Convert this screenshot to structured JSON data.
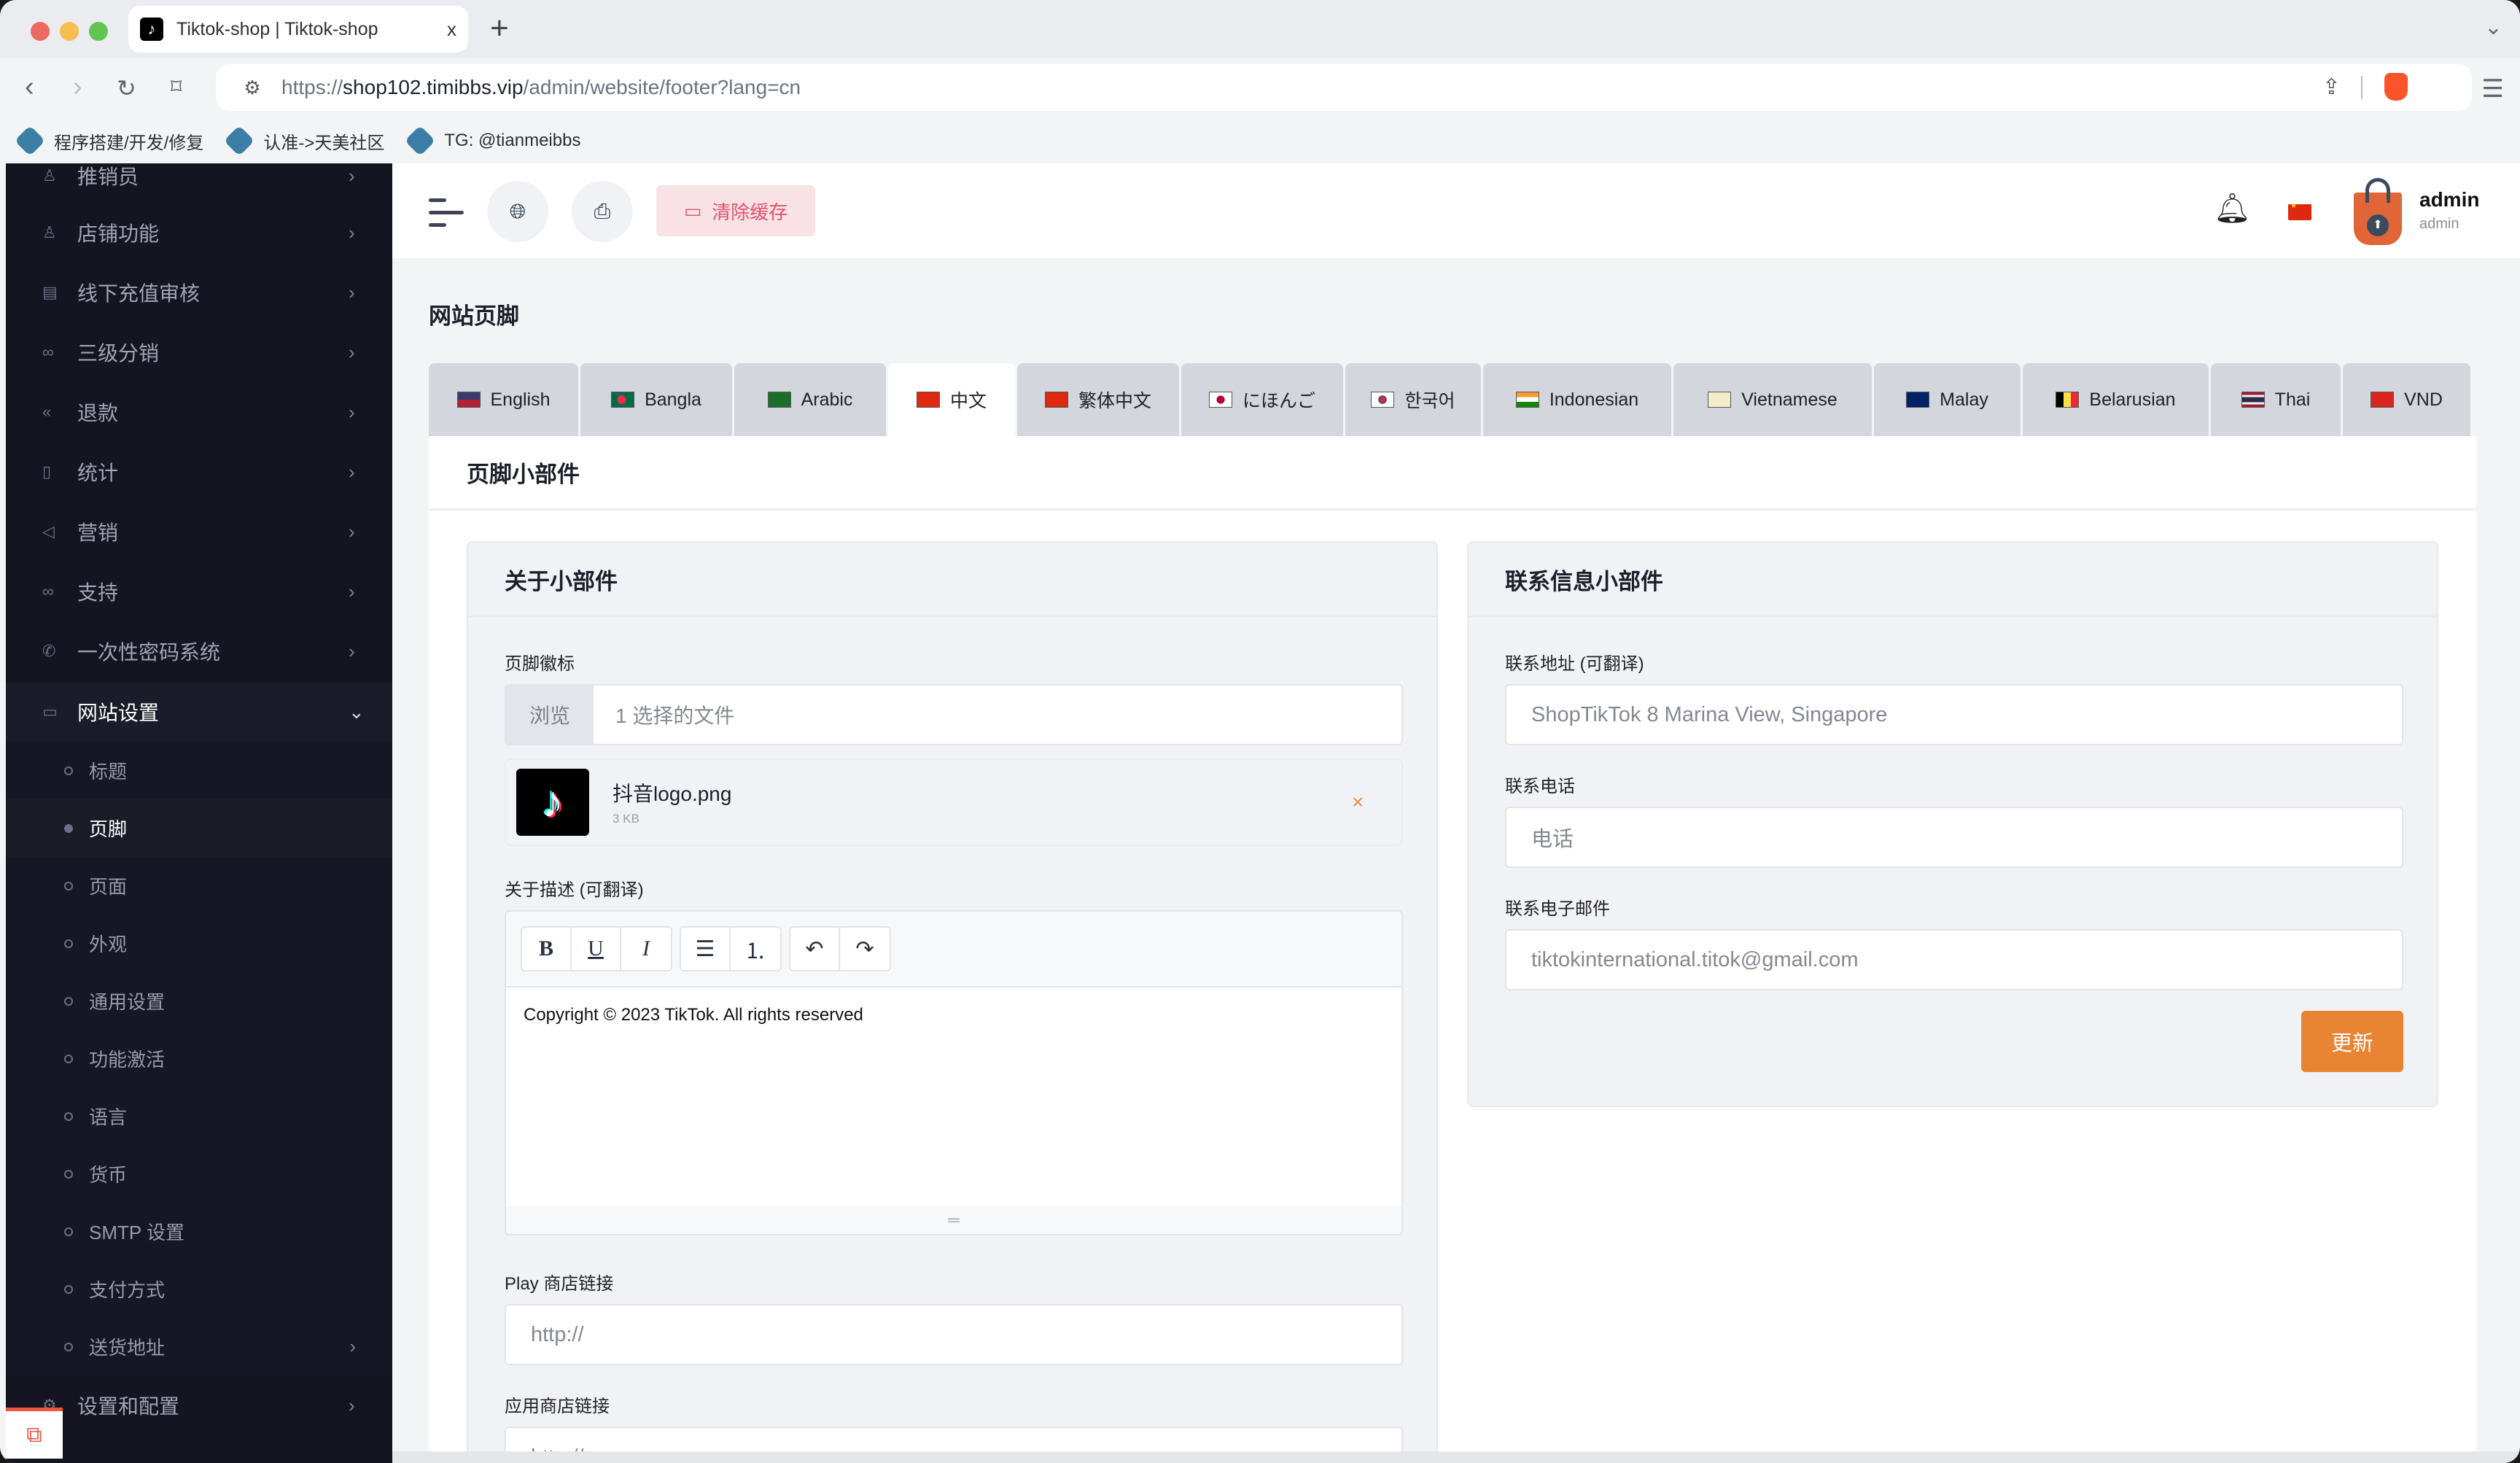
{
  "browser": {
    "tab_title": "Tiktok-shop | Tiktok-shop",
    "tab_close": "x",
    "new_tab": "+",
    "url_prefix": "https://",
    "url_host": "shop102.timibbs.vip",
    "url_path": "/admin/website/footer?lang=cn",
    "bookmarks": [
      {
        "label": "程序搭建/开发/修复"
      },
      {
        "label": "认准->天美社区"
      },
      {
        "label": "TG: @tianmeibbs"
      }
    ]
  },
  "sidebar": {
    "items": [
      {
        "label": "推销员",
        "icon": "user-icon"
      },
      {
        "label": "店铺功能",
        "icon": "user-icon"
      },
      {
        "label": "线下充值审核",
        "icon": "money-check-icon"
      },
      {
        "label": "三级分销",
        "icon": "link-icon"
      },
      {
        "label": "退款",
        "icon": "rewind-icon"
      },
      {
        "label": "统计",
        "icon": "document-icon"
      },
      {
        "label": "营销",
        "icon": "megaphone-icon"
      },
      {
        "label": "支持",
        "icon": "link-icon"
      },
      {
        "label": "一次性密码系统",
        "icon": "phone-icon"
      },
      {
        "label": "网站设置",
        "icon": "monitor-icon",
        "expanded": true
      }
    ],
    "subitems": [
      {
        "label": "标题"
      },
      {
        "label": "页脚",
        "active": true
      },
      {
        "label": "页面"
      },
      {
        "label": "外观"
      },
      {
        "label": "通用设置"
      },
      {
        "label": "功能激活"
      },
      {
        "label": "语言"
      },
      {
        "label": "货币"
      },
      {
        "label": "SMTP 设置"
      },
      {
        "label": "支付方式"
      },
      {
        "label": "送货地址",
        "has_children": true
      }
    ],
    "bottom_item": {
      "label": "设置和配置",
      "icon": "gear-icon"
    }
  },
  "header": {
    "clear_cache_label": "清除缓存",
    "user_name": "admin",
    "user_role": "admin"
  },
  "page": {
    "title": "网站页脚",
    "language_tabs": [
      {
        "label": "English",
        "flag": "us"
      },
      {
        "label": "Bangla",
        "flag": "bd"
      },
      {
        "label": "Arabic",
        "flag": "sa"
      },
      {
        "label": "中文",
        "flag": "cn",
        "active": true
      },
      {
        "label": "繁体中文",
        "flag": "hk"
      },
      {
        "label": "にほんご",
        "flag": "jp"
      },
      {
        "label": "한국어",
        "flag": "kr"
      },
      {
        "label": "Indonesian",
        "flag": "in"
      },
      {
        "label": "Vietnamese",
        "flag": "vi"
      },
      {
        "label": "Malay",
        "flag": "my"
      },
      {
        "label": "Belarusian",
        "flag": "be"
      },
      {
        "label": "Thai",
        "flag": "th"
      },
      {
        "label": "VND",
        "flag": "vn"
      }
    ],
    "card_title": "页脚小部件",
    "about": {
      "title": "关于小部件",
      "logo_label": "页脚徽标",
      "browse_label": "浏览",
      "file_count_text": "1 选择的文件",
      "file_name": "抖音logo.png",
      "file_size": "3 KB",
      "remove_icon": "×",
      "desc_label": "关于描述 (可翻译)",
      "toolbar": {
        "bold": "B",
        "underline": "U",
        "italic": "I"
      },
      "desc_content": "Copyright © 2023 TikTok. All rights reserved",
      "play_label": "Play 商店链接",
      "play_placeholder": "http://",
      "appstore_label": "应用商店链接",
      "appstore_placeholder": "http://"
    },
    "contact": {
      "title": "联系信息小部件",
      "address_label": "联系地址 (可翻译)",
      "address_value": "ShopTikTok 8 Marina View, Singapore",
      "phone_label": "联系电话",
      "phone_placeholder": "电话",
      "email_label": "联系电子邮件",
      "email_value": "tiktokinternational.titok@gmail.com",
      "update_label": "更新"
    }
  },
  "colors": {
    "sidebar_bg": "#151521",
    "accent_orange": "#e88432",
    "clear_cache_text": "#e2526d",
    "clear_cache_bg": "#f9e2e6"
  }
}
